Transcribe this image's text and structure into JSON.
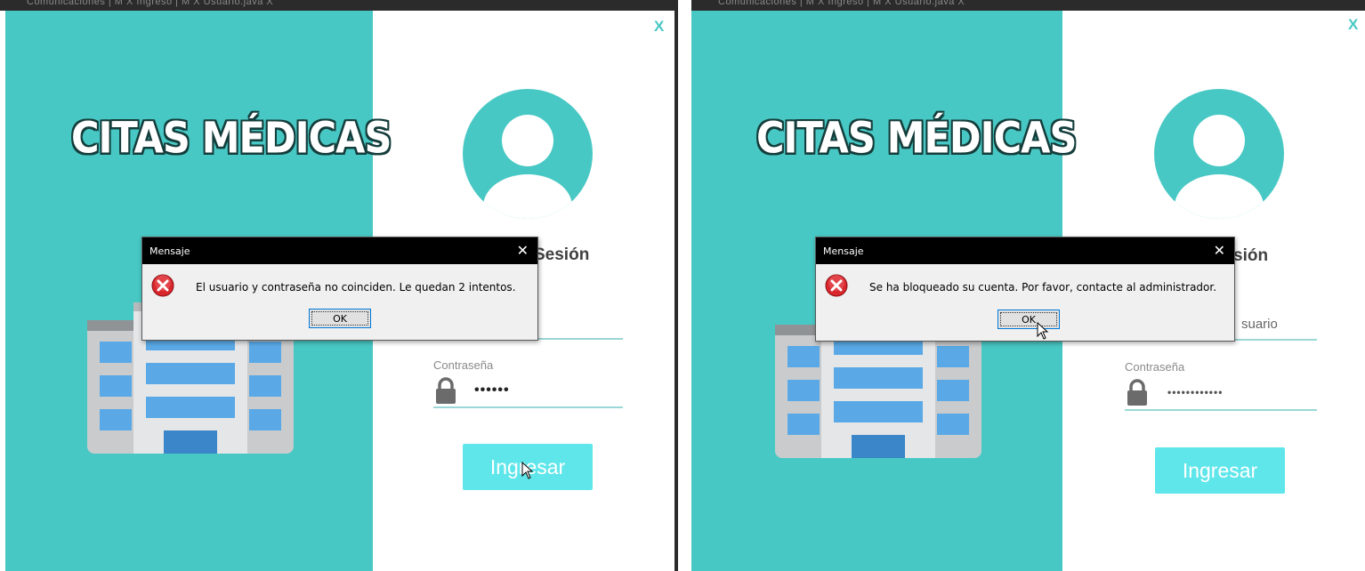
{
  "left": {
    "tab_strip": "Comunicaciones | M X   Ingreso | M X   Usuario.java X",
    "brand": "CITAS MÉDICAS",
    "close_label": "X",
    "title_partial": "Sesión",
    "password_label": "Contraseña",
    "password_value": "••••••",
    "login_button": "Ingresar",
    "dialog": {
      "title": "Mensaje",
      "close": "✕",
      "message": "El usuario y contraseña no coinciden. Le quedan 2 intentos.",
      "ok": "OK"
    }
  },
  "right": {
    "tab_strip": "Comunicaciones | M X   Ingreso | M X   Usuario.java X",
    "brand": "CITAS MÉDICAS",
    "close_label": "X",
    "title_partial": "sión",
    "user_partial": "suario",
    "password_label": "Contraseña",
    "password_value": "••••••••••••",
    "login_button": "Ingresar",
    "dialog": {
      "title": "Mensaje",
      "close": "✕",
      "message": "Se ha bloqueado su cuenta. Por favor, contacte al administrador.",
      "ok": "OK"
    }
  },
  "colors": {
    "teal": "#48c8c4",
    "button": "#5fe6ea",
    "dialog_title_bar": "#000000",
    "building_window": "#5aa9e6"
  },
  "icons": {
    "error": "error-icon",
    "avatar": "user-avatar-icon",
    "lock": "lock-icon",
    "building": "hospital-building-icon"
  }
}
